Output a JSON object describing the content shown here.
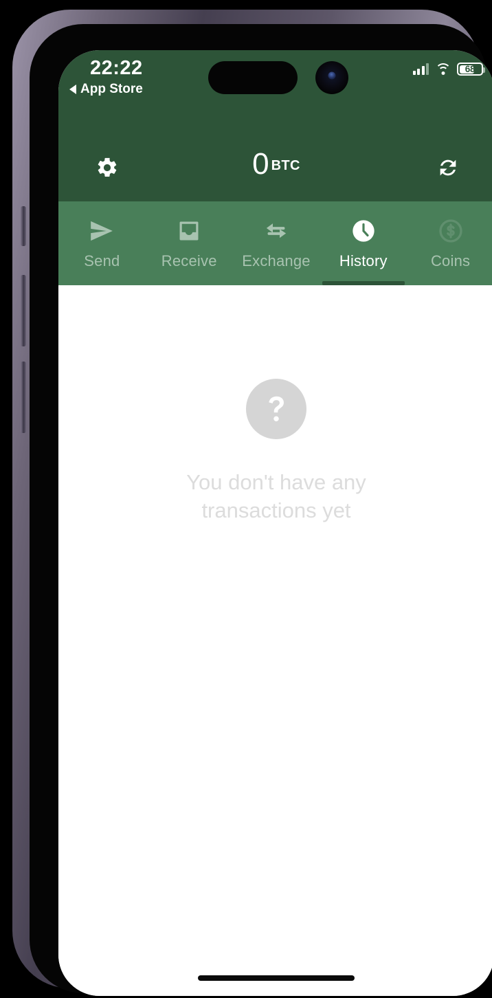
{
  "status_bar": {
    "time": "22:22",
    "back_label": "App Store",
    "back_icon": "triangle-left-icon",
    "cellular_icon": "signal-bars-icon",
    "wifi_icon": "wifi-icon",
    "battery_percent": "68",
    "battery_icon": "battery-icon"
  },
  "header": {
    "settings_icon": "gear-icon",
    "refresh_icon": "refresh-icon",
    "balance_amount": "0",
    "balance_currency": "BTC",
    "background_color": "#2d5438"
  },
  "tabs": {
    "background_color": "#497f59",
    "active_indicator_color": "#2d5438",
    "items": [
      {
        "label": "Send",
        "icon": "paper-plane-icon",
        "active": false
      },
      {
        "label": "Receive",
        "icon": "inbox-tray-icon",
        "active": false
      },
      {
        "label": "Exchange",
        "icon": "swap-arrows-icon",
        "active": false
      },
      {
        "label": "History",
        "icon": "clock-icon",
        "active": true
      },
      {
        "label": "Coins",
        "icon": "dollar-circle-icon",
        "active": false
      }
    ]
  },
  "content": {
    "empty_state_icon": "question-mark-circle-icon",
    "empty_state_text": "You don't have any transactions yet",
    "background_color": "#ffffff"
  },
  "device": {
    "home_indicator": "home-indicator",
    "dynamic_island": "dynamic-island",
    "camera": "front-camera",
    "frame_color": "#6e6678"
  }
}
